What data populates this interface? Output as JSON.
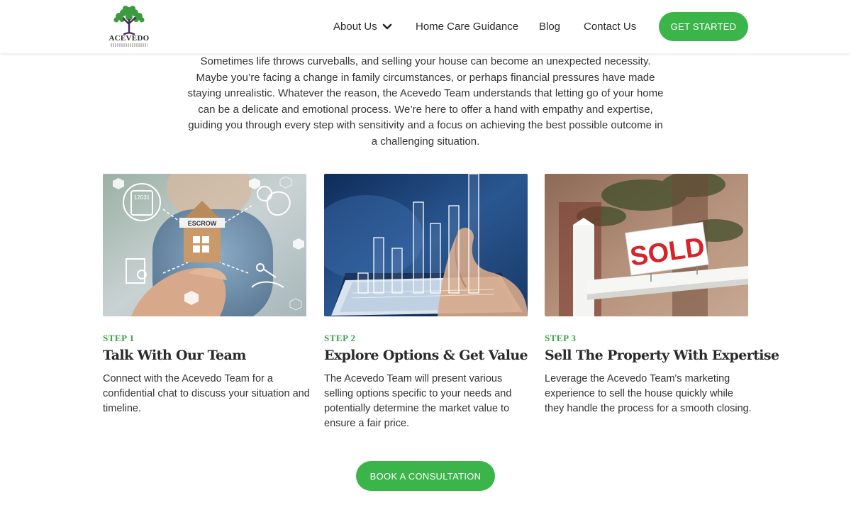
{
  "header": {
    "logo_text": "ACEVEDO",
    "nav": {
      "about": "About Us",
      "guidance": "Home Care Guidance",
      "blog": "Blog",
      "contact": "Contact Us"
    },
    "cta_label": "GET STARTED"
  },
  "intro": {
    "text": "Sometimes life throws curveballs, and selling your house can become an unexpected necessity. Maybe you’re facing a change in family circumstances, or perhaps financial pressures have made staying unrealistic. Whatever the reason, the Acevedo Team understands that letting go of your home can be a delicate and emotional process. We’re here to offer a hand with empathy and expertise, guiding you through every step with sensitivity and a focus on achieving the best possible outcome in a challenging situation."
  },
  "steps": [
    {
      "label": "STEP 1",
      "title": "Talk With Our Team",
      "text": "Connect with the Acevedo Team for a confidential chat to discuss your situation and timeline."
    },
    {
      "label": "STEP 2",
      "title": "Explore Options & Get Value",
      "text": "The Acevedo Team will present various selling options specific to your needs and potentially determine the market value to ensure a fair price."
    },
    {
      "label": "STEP 3",
      "title": "Sell The Property With Expertise",
      "text": "Leverage the Acevedo Team's marketing experience to sell the house quickly while they handle the process for a smooth closing."
    }
  ],
  "images": {
    "escrow_word": "ESCROW",
    "calc_readout": "12031",
    "sold_sign": "SOLD"
  },
  "consult_label": "BOOK A CONSULTATION",
  "colors": {
    "accent_green": "#3bb54a",
    "step_green": "#3aa04a",
    "sold_red": "#d8232a"
  }
}
